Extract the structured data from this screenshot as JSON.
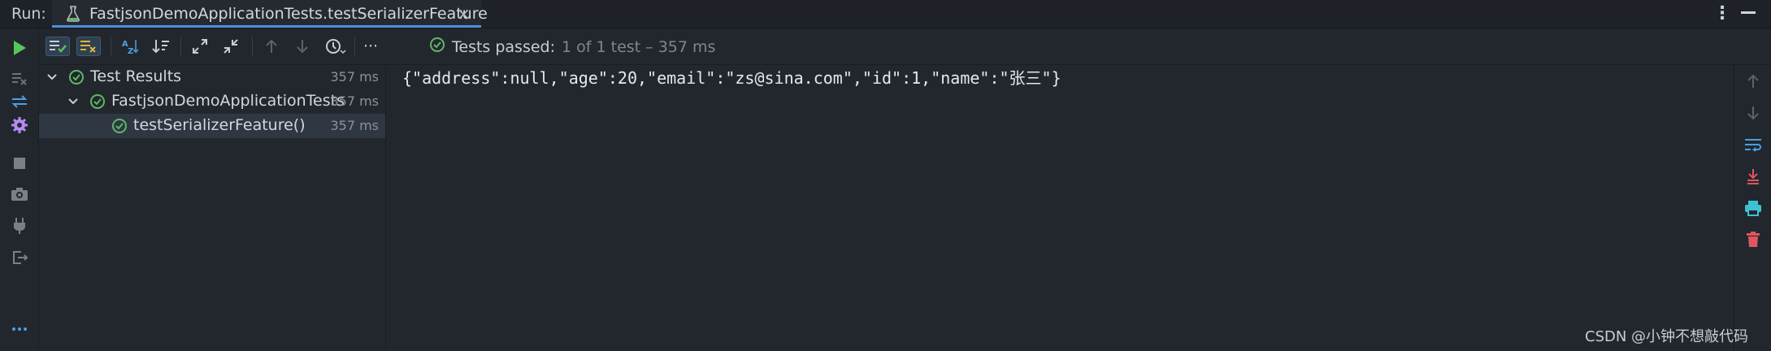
{
  "titlebar": {
    "run_label": "Run:",
    "tab_title": "FastjsonDemoApplicationTests.testSerializerFeature",
    "close_glyph": "×"
  },
  "toolbar": {
    "status_passed": "Tests passed:",
    "status_rest": "1 of 1 test – 357 ms",
    "more_glyph": "···"
  },
  "tree": {
    "items": [
      {
        "label": "Test Results",
        "time": "357 ms"
      },
      {
        "label": "FastjsonDemoApplicationTests",
        "time": "357 ms"
      },
      {
        "label": "testSerializerFeature()",
        "time": "357 ms"
      }
    ]
  },
  "console": {
    "output": "{\"address\":null,\"age\":20,\"email\":\"zs@sina.com\",\"id\":1,\"name\":\"张三\"}"
  },
  "watermark": "CSDN @小钟不想敲代码",
  "colors": {
    "accent_blue": "#4d8fd8",
    "pass_green": "#5fb865",
    "run_green": "#57c65a",
    "delete_red": "#e05561",
    "settings_purple": "#b38bf2"
  }
}
